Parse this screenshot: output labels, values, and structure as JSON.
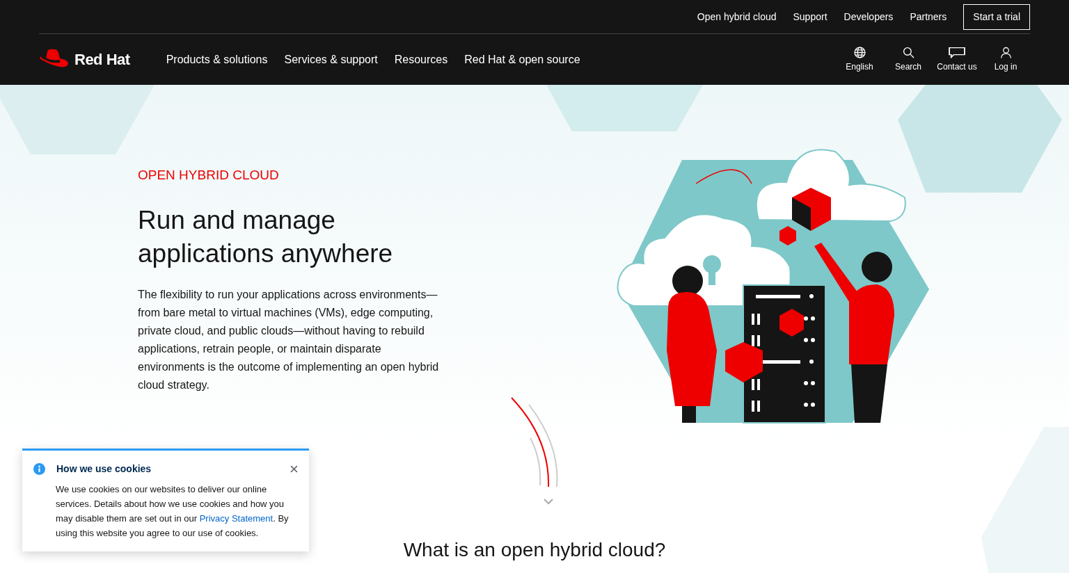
{
  "utility_nav": {
    "links": [
      "Open hybrid cloud",
      "Support",
      "Developers",
      "Partners"
    ],
    "trial_button": "Start a trial"
  },
  "main_nav": {
    "logo_text": "Red Hat",
    "links": [
      "Products & solutions",
      "Services & support",
      "Resources",
      "Red Hat & open source"
    ],
    "actions": [
      {
        "kind": "globe",
        "label": "English"
      },
      {
        "kind": "search",
        "label": "Search"
      },
      {
        "kind": "chat",
        "label": "Contact us"
      },
      {
        "kind": "user",
        "label": "Log in"
      }
    ]
  },
  "hero": {
    "eyebrow": "OPEN HYBRID CLOUD",
    "title": "Run and manage applications anywhere",
    "body": "The flexibility to run your applications across environments—from bare metal to virtual machines (VMs), edge computing, private cloud, and public clouds—without having to rebuild applications, retrain people, or maintain disparate environments is the outcome of implementing an open hybrid cloud strategy."
  },
  "section_heading": "What is an open hybrid cloud?",
  "cookie_notice": {
    "title": "How we use cookies",
    "text_before": "We use cookies on our websites to deliver our online services. Details about how we use cookies and how you may disable them are set out in our ",
    "link": "Privacy Statement",
    "text_after": ". By using this website you agree to our use of cookies."
  }
}
